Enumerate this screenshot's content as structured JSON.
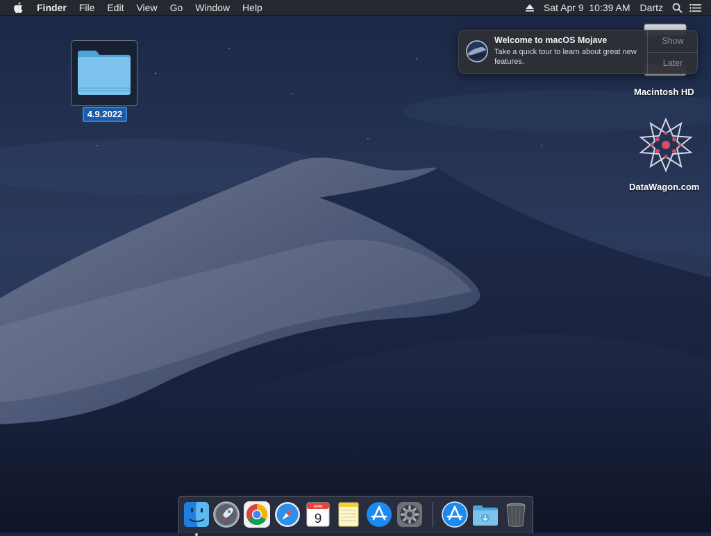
{
  "menubar": {
    "apple_icon": "apple-logo-icon",
    "app_name": "Finder",
    "menus": [
      "File",
      "Edit",
      "View",
      "Go",
      "Window",
      "Help"
    ],
    "status": {
      "eject_icon": "eject-icon",
      "datetime": "Sat Apr 9  10:39 AM",
      "user": "Dartz",
      "search_icon": "spotlight-search-icon",
      "notification_center_icon": "list-icon"
    }
  },
  "desktop": {
    "folder_name": "4.9.2022",
    "icons": [
      {
        "label": "Macintosh HD",
        "icon": "hard-drive-icon"
      },
      {
        "label": "DataWagon.com",
        "icon": "star-pattern-icon"
      }
    ]
  },
  "notification": {
    "title": "Welcome to macOS Mojave",
    "body": "Take a quick tour to learn about great new features.",
    "buttons": [
      "Show",
      "Later"
    ],
    "icon": "mojave-icon"
  },
  "dock": {
    "items": [
      {
        "name": "Finder",
        "icon": "finder-icon",
        "running": true
      },
      {
        "name": "Launchpad",
        "icon": "launchpad-rocket-icon"
      },
      {
        "name": "Google Chrome",
        "icon": "chrome-icon"
      },
      {
        "name": "Safari",
        "icon": "safari-compass-icon"
      },
      {
        "name": "Calendar",
        "icon": "calendar-icon",
        "month": "APR",
        "day": "9"
      },
      {
        "name": "Notes",
        "icon": "notes-icon"
      },
      {
        "name": "App Store",
        "icon": "app-store-icon"
      },
      {
        "name": "System Preferences",
        "icon": "gear-icon"
      },
      {
        "name": "Applications",
        "icon": "app-store-icon"
      },
      {
        "name": "Downloads",
        "icon": "downloads-folder-icon"
      },
      {
        "name": "Trash",
        "icon": "trash-icon"
      }
    ]
  }
}
